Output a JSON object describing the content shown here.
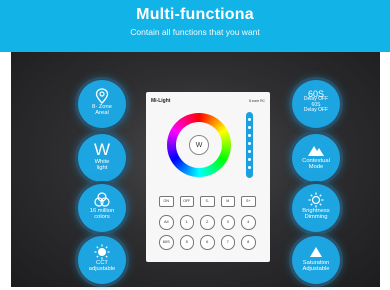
{
  "banner": {
    "title": "Multi-functiona",
    "subtitle": "Contain all functions that you want"
  },
  "features_left": [
    {
      "label": "8- Zone\nAreal",
      "icon": "map-pin-icon"
    },
    {
      "label": "White\nlight",
      "icon_text": "W"
    },
    {
      "label": "16 million\ncolors",
      "icon": "palette-icon"
    },
    {
      "label": "CCT\nadjustable",
      "icon": "bulb-sun-icon"
    }
  ],
  "features_right": [
    {
      "label": "Delay OFF",
      "icon_text": "60S",
      "sub": "Delay OFF",
      "sub2": "60S"
    },
    {
      "label": "Contextual\nMode",
      "icon": "mountain-icon"
    },
    {
      "label": "Brightness\nDimming",
      "icon": "sun-icon"
    },
    {
      "label": "Saturation\nAdjustable",
      "icon": "triangle-icon"
    }
  ],
  "remote": {
    "brand": "Mi-Light",
    "rc_label": "8 zone RC",
    "wheel_button": "W",
    "keys_row": [
      "ON",
      "OFF",
      "S-",
      "M",
      "S+"
    ],
    "circle_row1": [
      "All",
      "1",
      "2",
      "3",
      "4"
    ],
    "circle_row2": [
      "60S",
      "5",
      "6",
      "7",
      "8"
    ]
  },
  "colors": {
    "banner": "#12b3e6",
    "feature": "#1ca5e0",
    "slider": "#1aa0e0"
  }
}
